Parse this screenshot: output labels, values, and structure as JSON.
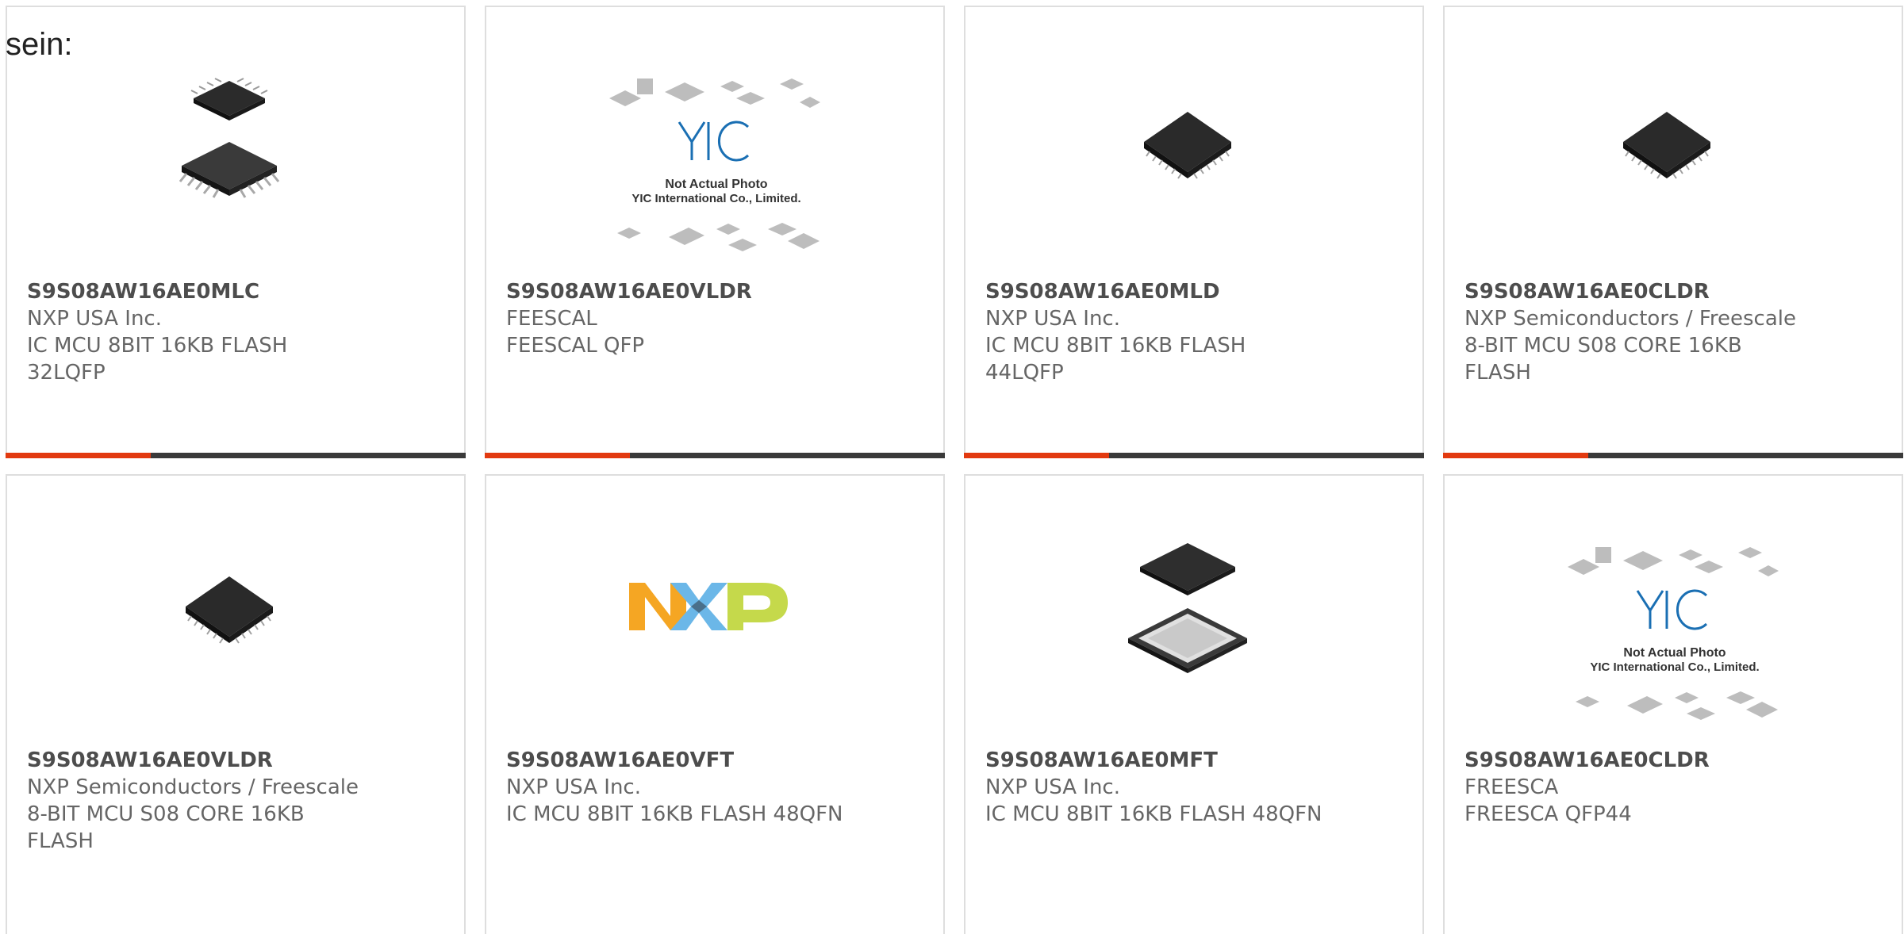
{
  "intro_text": "sein:",
  "colors": {
    "accent": "#e23a10",
    "bar": "#3a3a3a",
    "border": "#dedede",
    "text": "#666666"
  },
  "products": [
    {
      "part_number": "S9S08AW16AE0MLC",
      "manufacturer": "NXP USA Inc.",
      "description_line1": "IC MCU 8BIT 16KB FLASH",
      "description_line2": "32LQFP",
      "image": "qfp-chip-exploded-image"
    },
    {
      "part_number": "S9S08AW16AE0VLDR",
      "manufacturer": "FEESCAL",
      "description_line1": "FEESCAL QFP",
      "description_line2": "",
      "image": "yic-placeholder-image",
      "placeholder_line1": "Not Actual Photo",
      "placeholder_line2": "YIC International Co., Limited."
    },
    {
      "part_number": "S9S08AW16AE0MLD",
      "manufacturer": "NXP USA Inc.",
      "description_line1": "IC MCU 8BIT 16KB FLASH",
      "description_line2": "44LQFP",
      "image": "qfp-chip-image"
    },
    {
      "part_number": "S9S08AW16AE0CLDR",
      "manufacturer": "NXP Semiconductors / Freescale",
      "description_line1": "8-BIT MCU S08 CORE 16KB",
      "description_line2": "FLASH",
      "image": "qfp-chip-image"
    },
    {
      "part_number": "S9S08AW16AE0VLDR",
      "manufacturer": "NXP Semiconductors / Freescale",
      "description_line1": "8-BIT MCU S08 CORE 16KB",
      "description_line2": "FLASH",
      "image": "qfp-chip-image"
    },
    {
      "part_number": "S9S08AW16AE0VFT",
      "manufacturer": "NXP USA Inc.",
      "description_line1": "IC MCU 8BIT 16KB FLASH 48QFN",
      "description_line2": "",
      "image": "nxp-logo-image"
    },
    {
      "part_number": "S9S08AW16AE0MFT",
      "manufacturer": "NXP USA Inc.",
      "description_line1": "IC MCU 8BIT 16KB FLASH 48QFN",
      "description_line2": "",
      "image": "qfn-chip-exploded-image"
    },
    {
      "part_number": "S9S08AW16AE0CLDR",
      "manufacturer": "FREESCA",
      "description_line1": "FREESCA QFP44",
      "description_line2": "",
      "image": "yic-placeholder-image",
      "placeholder_line1": "Not Actual Photo",
      "placeholder_line2": "YIC International Co., Limited."
    }
  ]
}
